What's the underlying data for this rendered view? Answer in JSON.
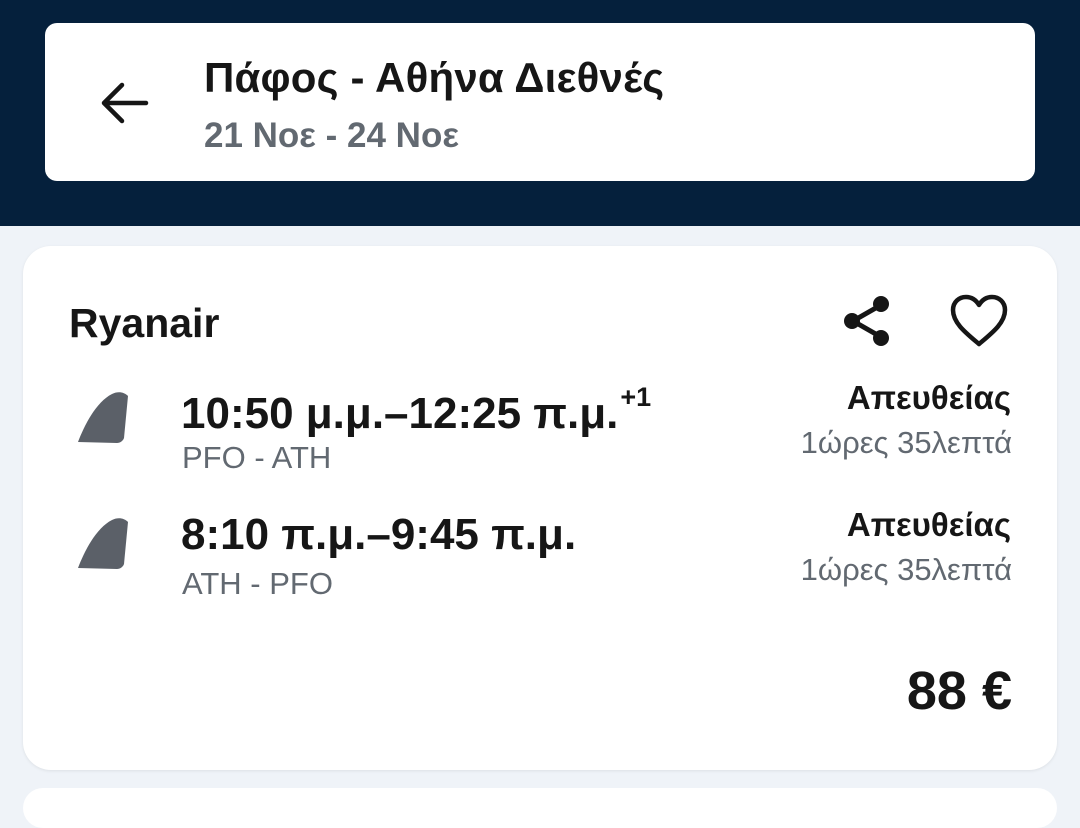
{
  "header": {
    "title": "Πάφος - Αθήνα Διεθνές",
    "dates": "21 Νοε - 24 Νοε",
    "back_icon": "arrow-left-icon"
  },
  "result": {
    "airline": "Ryanair",
    "share_icon": "share-icon",
    "favorite_icon": "heart-outline-icon",
    "legs": [
      {
        "times": "10:50 μ.μ.–12:25 π.μ.",
        "day_offset": "+1",
        "route": "PFO - ATH",
        "stops": "Απευθείας",
        "duration": "1ώρες 35λεπτά",
        "logo_icon": "airline-tail-icon"
      },
      {
        "times": "8:10 π.μ.–9:45 π.μ.",
        "day_offset": "",
        "route": "ATH - PFO",
        "stops": "Απευθείας",
        "duration": "1ώρες 35λεπτά",
        "logo_icon": "airline-tail-icon"
      }
    ],
    "price": "88 €"
  },
  "colors": {
    "header_bg": "#05203c",
    "page_bg": "#eff3f8",
    "text_primary": "#161616",
    "text_secondary": "#626971",
    "tail_logo": "#5b6068"
  }
}
